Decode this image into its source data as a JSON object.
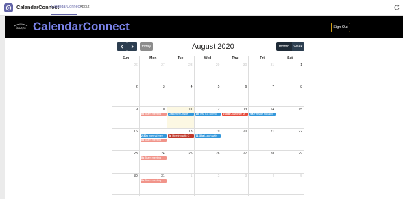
{
  "appbar": {
    "app_name": "CalendarConnect",
    "tabs": [
      {
        "label": "CalendarConnect",
        "active": true
      },
      {
        "label": "About",
        "active": false
      }
    ],
    "refresh_icon": "refresh-icon"
  },
  "header": {
    "logo_text": "tocsys",
    "title": "CalendarConnect",
    "signout_label": "Sign Out"
  },
  "toolbar": {
    "prev_icon": "chevron-left-icon",
    "next_icon": "chevron-right-icon",
    "today_label": "today",
    "title": "August 2020",
    "month_label": "month",
    "week_label": "week"
  },
  "calendar": {
    "day_names": [
      "Sun",
      "Mon",
      "Tue",
      "Wed",
      "Thu",
      "Fri",
      "Sat"
    ],
    "weeks": [
      {
        "days": [
          {
            "n": "26",
            "other": true
          },
          {
            "n": "27",
            "other": true
          },
          {
            "n": "28",
            "other": true
          },
          {
            "n": "29",
            "other": true
          },
          {
            "n": "30",
            "other": true
          },
          {
            "n": "31",
            "other": true
          },
          {
            "n": "1",
            "other": false
          }
        ]
      },
      {
        "days": [
          {
            "n": "2",
            "other": false
          },
          {
            "n": "3",
            "other": false
          },
          {
            "n": "4",
            "other": false
          },
          {
            "n": "5",
            "other": false
          },
          {
            "n": "6",
            "other": false
          },
          {
            "n": "7",
            "other": false
          },
          {
            "n": "8",
            "other": false
          }
        ]
      },
      {
        "days": [
          {
            "n": "9",
            "other": false
          },
          {
            "n": "10",
            "other": false
          },
          {
            "n": "11",
            "other": false,
            "today": true
          },
          {
            "n": "12",
            "other": false
          },
          {
            "n": "13",
            "other": false
          },
          {
            "n": "14",
            "other": false
          },
          {
            "n": "15",
            "other": false
          }
        ]
      },
      {
        "days": [
          {
            "n": "16",
            "other": false
          },
          {
            "n": "17",
            "other": false
          },
          {
            "n": "18",
            "other": false
          },
          {
            "n": "19",
            "other": false
          },
          {
            "n": "20",
            "other": false
          },
          {
            "n": "21",
            "other": false
          },
          {
            "n": "22",
            "other": false
          }
        ]
      },
      {
        "days": [
          {
            "n": "23",
            "other": false
          },
          {
            "n": "24",
            "other": false
          },
          {
            "n": "25",
            "other": false
          },
          {
            "n": "26",
            "other": false
          },
          {
            "n": "27",
            "other": false
          },
          {
            "n": "28",
            "other": false
          },
          {
            "n": "29",
            "other": false
          }
        ]
      },
      {
        "days": [
          {
            "n": "30",
            "other": false
          },
          {
            "n": "31",
            "other": false
          },
          {
            "n": "1",
            "other": true
          },
          {
            "n": "2",
            "other": true
          },
          {
            "n": "3",
            "other": true
          },
          {
            "n": "4",
            "other": true
          },
          {
            "n": "5",
            "other": true
          }
        ]
      }
    ],
    "events": [
      {
        "week": 2,
        "day": 1,
        "slot": 0,
        "time": "5p",
        "title": "Team meeting",
        "color": "salmon"
      },
      {
        "week": 2,
        "day": 2,
        "slot": 0,
        "time": "",
        "title": "Customer Onsite",
        "color": "blue"
      },
      {
        "week": 2,
        "day": 3,
        "slot": 0,
        "time": "1p",
        "title": "Test CC Demo",
        "color": "blue"
      },
      {
        "week": 2,
        "day": 4,
        "slot": 0,
        "time": "2:30p",
        "title": "Customer M",
        "color": "red"
      },
      {
        "week": 2,
        "day": 5,
        "slot": 0,
        "time": "9a",
        "title": "Fireside focused",
        "color": "blue"
      },
      {
        "week": 3,
        "day": 1,
        "slot": 0,
        "time": "2:30p",
        "title": "Internal mee",
        "color": "blue"
      },
      {
        "week": 3,
        "day": 1,
        "slot": 1,
        "time": "5p",
        "title": "Team meeting",
        "color": "salmon"
      },
      {
        "week": 3,
        "day": 2,
        "slot": 0,
        "time": "5p",
        "title": "Meeting with C",
        "color": "darkred"
      },
      {
        "week": 3,
        "day": 3,
        "slot": 0,
        "time": "11:30a",
        "title": "Lunch with",
        "color": "blue"
      },
      {
        "week": 4,
        "day": 1,
        "slot": 0,
        "time": "5p",
        "title": "Team meeting",
        "color": "salmon"
      },
      {
        "week": 5,
        "day": 1,
        "slot": 0,
        "time": "5p",
        "title": "Team meeting",
        "color": "salmon"
      }
    ]
  },
  "colors": {
    "accent": "#6264a7",
    "header_bg": "#000000",
    "title_color": "#7b83eb",
    "event_red": "#e74c3c",
    "event_salmon": "#f1948a",
    "event_blue": "#3498db",
    "event_darkred": "#c0392b",
    "today_bg": "#fcf8e3"
  }
}
